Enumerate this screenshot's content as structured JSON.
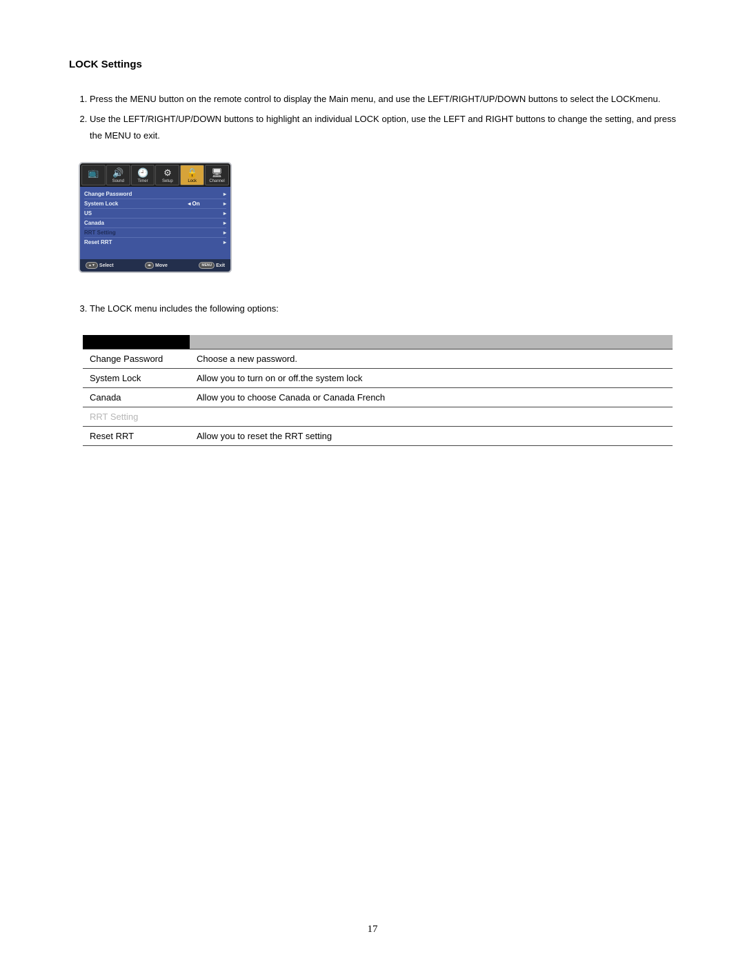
{
  "title": "LOCK Settings",
  "steps": [
    "Press the   MENU button on the remote control to display the Main menu, and use the LEFT/RIGHT/UP/DOWN buttons to select the LOCKmenu.",
    "Use the LEFT/RIGHT/UP/DOWN buttons to highlight an individual LOCK option, use the LEFT and RIGHT buttons to change the setting, and press the   MENU to exit."
  ],
  "step3": "The LOCK menu includes the following options:",
  "osd": {
    "tabs": [
      {
        "label": "",
        "icon": "📺"
      },
      {
        "label": "Sound",
        "icon": "🔊"
      },
      {
        "label": "Timer",
        "icon": "🕘"
      },
      {
        "label": "Setup",
        "icon": "⚙"
      },
      {
        "label": "Lock",
        "icon": "🔒",
        "selected": true
      },
      {
        "label": "Channel",
        "icon": "🖥"
      }
    ],
    "rows": [
      {
        "label": "Change Password",
        "value": "",
        "arrow": "▸"
      },
      {
        "label": "System Lock",
        "value": "◂    On",
        "arrow": "▸"
      },
      {
        "label": "US",
        "value": "",
        "arrow": "▸"
      },
      {
        "label": "Canada",
        "value": "",
        "arrow": "▸"
      },
      {
        "label": "RRT Setting",
        "value": "",
        "arrow": "▸",
        "dim": true
      },
      {
        "label": "Reset RRT",
        "value": "",
        "arrow": "▸"
      }
    ],
    "footer": {
      "select": "Select",
      "move": "Move",
      "exit": "Exit",
      "exitKey": "MENU"
    }
  },
  "options": [
    {
      "name": "Change Password",
      "desc": "Choose a new password."
    },
    {
      "name": "System Lock",
      "desc": "Allow you to turn on or off.the system lock"
    },
    {
      "name": "Canada",
      "desc": "Allow you to choose Canada or Canada French"
    },
    {
      "name": "RRT Setting",
      "desc": "",
      "dim": true
    },
    {
      "name": "Reset RRT",
      "desc": "Allow you to reset the RRT setting"
    }
  ],
  "pageNumber": "17"
}
